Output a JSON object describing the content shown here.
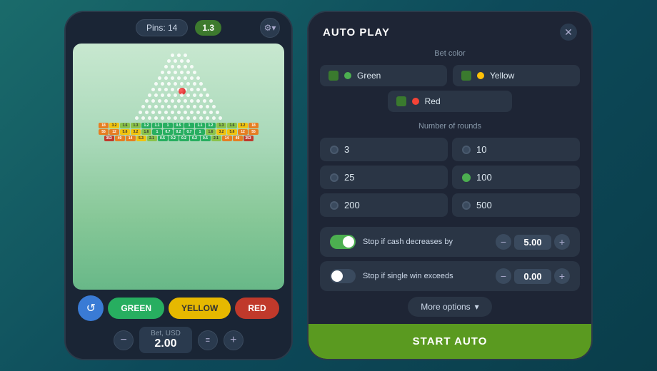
{
  "left_phone": {
    "pins_label": "Pins: 14",
    "multiplier": "1.3",
    "bet_label": "Bet, USD",
    "bet_amount": "2.00",
    "btn_green": "GREEN",
    "btn_yellow": "YELLOW",
    "btn_red": "RED",
    "pin_rows": [
      3,
      4,
      5,
      6,
      7,
      8,
      9,
      10,
      11,
      12,
      13,
      14
    ],
    "multiplier_rows": [
      [
        "18",
        "3.2",
        "1.6",
        "1.3",
        "1.2",
        "1.1",
        "1",
        "0.5",
        "1",
        "1.1",
        "1.2",
        "1.3",
        "1.6",
        "3.2",
        "18"
      ],
      [
        "55",
        "12",
        "5.6",
        "3.2",
        "1.6",
        "1",
        "0.7",
        "0.2",
        "0.7",
        "1",
        "1.6",
        "3.2",
        "5.6",
        "12",
        "55"
      ],
      [
        "353",
        "49",
        "14",
        "5.3",
        "2.1",
        "0.5",
        "0.2",
        "0.2",
        "0.2",
        "0.5",
        "2.1",
        "14",
        "49",
        "353"
      ]
    ]
  },
  "right_panel": {
    "title": "AUTO PLAY",
    "close_label": "✕",
    "section_bet_color": "Bet color",
    "colors": [
      {
        "name": "Green",
        "dot": "green",
        "active": true
      },
      {
        "name": "Yellow",
        "dot": "yellow",
        "active": true
      },
      {
        "name": "Red",
        "dot": "red",
        "active": true
      }
    ],
    "section_rounds": "Number of rounds",
    "rounds": [
      {
        "value": "3",
        "active": false
      },
      {
        "value": "10",
        "active": false
      },
      {
        "value": "25",
        "active": false
      },
      {
        "value": "100",
        "active": true
      },
      {
        "value": "200",
        "active": false
      },
      {
        "value": "500",
        "active": false
      }
    ],
    "stop_conditions": [
      {
        "label": "Stop if cash decreases by",
        "toggle_on": true,
        "value": "5.00"
      },
      {
        "label": "Stop if single win exceeds",
        "toggle_on": false,
        "value": "0.00"
      }
    ],
    "more_options": "More options",
    "start_btn": "START AUTO"
  }
}
